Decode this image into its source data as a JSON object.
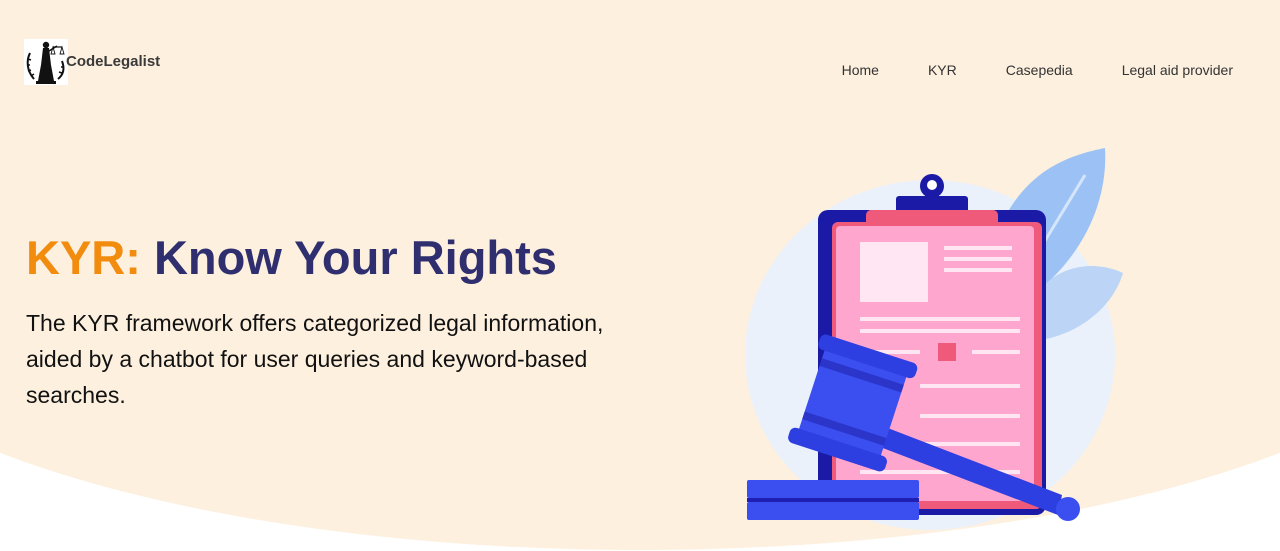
{
  "brand": {
    "name": "CodeLegalist",
    "logo_icon": "scales-of-justice-icon"
  },
  "nav": {
    "items": [
      {
        "label": "Home"
      },
      {
        "label": "KYR"
      },
      {
        "label": "Casepedia"
      },
      {
        "label": "Legal aid provider"
      }
    ]
  },
  "hero": {
    "title_accent": "KYR:",
    "title_main": " Know Your Rights",
    "description": "The KYR framework offers categorized legal information, aided by a chatbot for user queries and keyword-based searches.",
    "illustration": "clipboard-and-gavel-illustration"
  },
  "colors": {
    "background": "#fdf0df",
    "accent": "#f28c0f",
    "heading": "#2f2f6f",
    "illustration_blue": "#3b4ef0",
    "illustration_pink": "#ff9ec8"
  }
}
